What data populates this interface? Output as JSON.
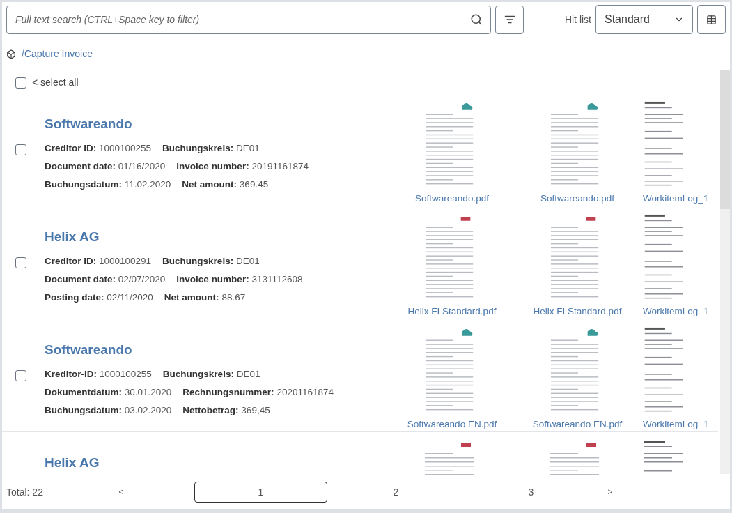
{
  "search": {
    "placeholder": "Full text search (CTRL+Space key to filter)"
  },
  "hit_list": {
    "label": "Hit list",
    "value": "Standard"
  },
  "breadcrumb": "/Capture Invoice",
  "select_all": {
    "label": "< select all",
    "checked": false
  },
  "results": [
    {
      "title": "Softwareando",
      "checked": false,
      "fields": [
        [
          {
            "label": "Creditor ID:",
            "value": "1000100255"
          },
          {
            "label": "Buchungskreis:",
            "value": "DE01"
          }
        ],
        [
          {
            "label": "Document date:",
            "value": "01/16/2020"
          },
          {
            "label": "Invoice number:",
            "value": "20191161874"
          }
        ],
        [
          {
            "label": "Buchungsdatum:",
            "value": "11.02.2020"
          },
          {
            "label": "Net amount:",
            "value": "369.45"
          }
        ]
      ],
      "documents": [
        {
          "kind": "invoice-logo",
          "caption": "Softwareando.pdf"
        },
        {
          "kind": "invoice-logo",
          "caption": "Softwareando.pdf"
        },
        {
          "kind": "log",
          "caption": "WorkitemLog_1"
        }
      ]
    },
    {
      "title": "Helix AG",
      "checked": false,
      "fields": [
        [
          {
            "label": "Creditor ID:",
            "value": "1000100291"
          },
          {
            "label": "Buchungskreis:",
            "value": "DE01"
          }
        ],
        [
          {
            "label": "Document date:",
            "value": "02/07/2020"
          },
          {
            "label": "Invoice number:",
            "value": "3131112608"
          }
        ],
        [
          {
            "label": "Posting date:",
            "value": "02/11/2020"
          },
          {
            "label": "Net amount:",
            "value": "88.67"
          }
        ]
      ],
      "documents": [
        {
          "kind": "invoice-red",
          "caption": "Helix FI Standard.pdf"
        },
        {
          "kind": "invoice-red",
          "caption": "Helix FI Standard.pdf"
        },
        {
          "kind": "log",
          "caption": "WorkitemLog_1"
        }
      ]
    },
    {
      "title": "Softwareando",
      "checked": false,
      "fields": [
        [
          {
            "label": "Kreditor-ID:",
            "value": "1000100255"
          },
          {
            "label": "Buchungskreis:",
            "value": "DE01"
          }
        ],
        [
          {
            "label": "Dokumentdatum:",
            "value": "30.01.2020"
          },
          {
            "label": "Rechnungsnummer:",
            "value": "20201161874"
          }
        ],
        [
          {
            "label": "Buchungsdatum:",
            "value": "03.02.2020"
          },
          {
            "label": "Nettobetrag:",
            "value": "369,45"
          }
        ]
      ],
      "documents": [
        {
          "kind": "invoice-logo",
          "caption": "Softwareando EN.pdf"
        },
        {
          "kind": "invoice-logo",
          "caption": "Softwareando EN.pdf"
        },
        {
          "kind": "log",
          "caption": "WorkitemLog_1"
        }
      ]
    },
    {
      "title": "Helix AG",
      "documents": [
        {
          "kind": "invoice-red"
        },
        {
          "kind": "invoice-red"
        },
        {
          "kind": "log"
        }
      ]
    }
  ],
  "pagination": {
    "total": "Total: 22",
    "prev": "<",
    "next": ">",
    "pages": [
      {
        "label": "1",
        "selected": true
      },
      {
        "label": "2",
        "selected": false
      },
      {
        "label": "3",
        "selected": false
      }
    ]
  }
}
